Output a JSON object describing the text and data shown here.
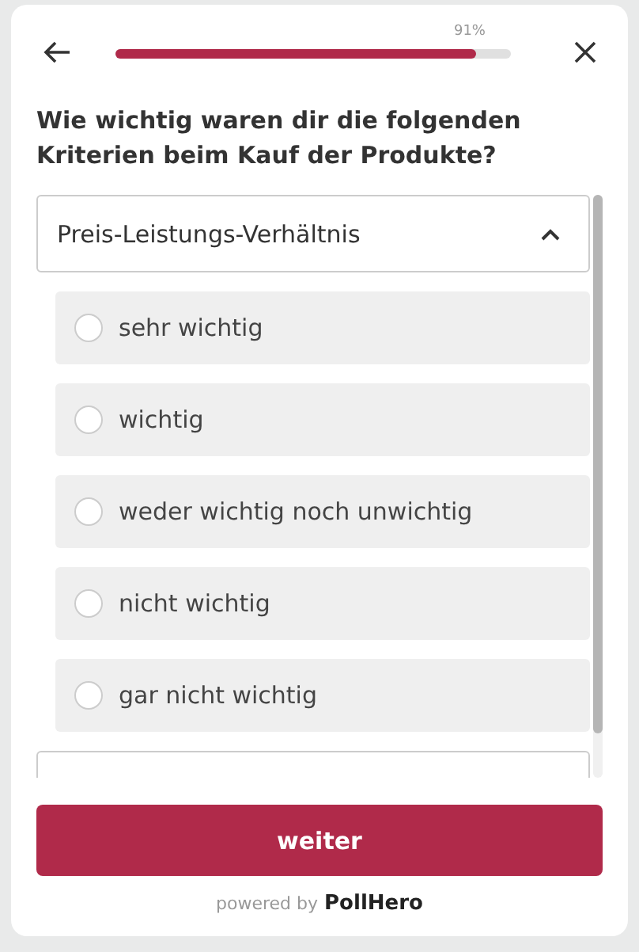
{
  "progress": {
    "level": 0.91,
    "reading": "91%"
  },
  "question": "Wie wichtig waren dir die folgenden Kriterien beim Kauf der Produkte?",
  "criteria": [
    {
      "label": "Preis-Leistungs-Verhältnis",
      "expanded": true,
      "options": [
        {
          "label": "sehr wichtig",
          "selected": false
        },
        {
          "label": "wichtig",
          "selected": false
        },
        {
          "label": "weder wichtig noch unwichtig",
          "selected": false
        },
        {
          "label": "nicht wichtig",
          "selected": false
        },
        {
          "label": "gar nicht wichtig",
          "selected": false
        }
      ]
    },
    {
      "expanded": false
    }
  ],
  "button": "weiter",
  "footer": {
    "powered": "powered by",
    "brand": "PollHero"
  }
}
